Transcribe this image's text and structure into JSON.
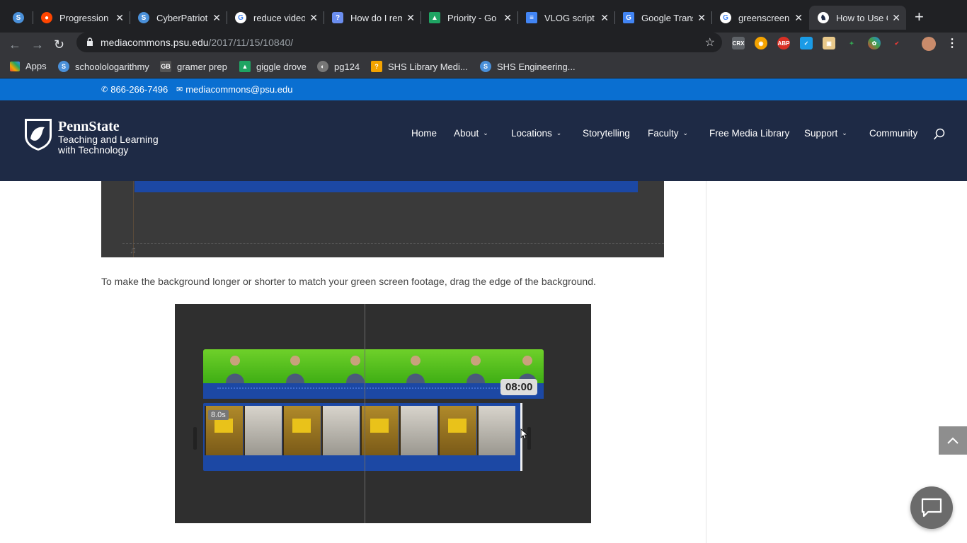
{
  "browser": {
    "tabs": [
      {
        "title": "",
        "icon": "schoology-icon",
        "color": "#4a90d9"
      },
      {
        "title": "Progression",
        "icon": "reddit-icon",
        "color": "#ff4500"
      },
      {
        "title": "CyberPatriot",
        "icon": "schoology-icon",
        "color": "#4a90d9"
      },
      {
        "title": "reduce video",
        "icon": "google-icon",
        "color": "#ffffff"
      },
      {
        "title": "How do I rem",
        "icon": "help-icon",
        "color": "#6b8ef0"
      },
      {
        "title": "Priority - Go",
        "icon": "drive-icon",
        "color": "#1fa463"
      },
      {
        "title": "VLOG script",
        "icon": "docs-icon",
        "color": "#4285f4"
      },
      {
        "title": "Google Trans",
        "icon": "translate-icon",
        "color": "#4285f4"
      },
      {
        "title": "greenscreen",
        "icon": "google-icon",
        "color": "#ffffff"
      },
      {
        "title": "How to Use G",
        "icon": "pennstate-icon",
        "color": "#ffffff"
      }
    ],
    "url_host": "mediacommons.psu.edu",
    "url_path": "/2017/11/15/10840/",
    "bookmarks": [
      {
        "label": "Apps",
        "icon": "apps-grid-icon",
        "color": "#e8453c"
      },
      {
        "label": "schoolologarithmy",
        "icon": "schoology-icon",
        "color": "#4a90d9"
      },
      {
        "label": "gramer prep",
        "icon": "gbi-icon",
        "color": "#555555"
      },
      {
        "label": "giggle drove",
        "icon": "drive-icon",
        "color": "#1fa463"
      },
      {
        "label": "pg124",
        "icon": "globe-icon",
        "color": "#777777"
      },
      {
        "label": "SHS Library Medi...",
        "icon": "library-icon",
        "color": "#f4a300"
      },
      {
        "label": "SHS Engineering...",
        "icon": "schoology-icon",
        "color": "#4a90d9"
      }
    ]
  },
  "site": {
    "phone": "866-266-7496",
    "email": "mediacommons@psu.edu",
    "logo_name": "PennState",
    "logo_sub": "Teaching and Learning with Technology",
    "nav": [
      "Home",
      "About",
      "Locations",
      "Storytelling",
      "Faculty",
      "Free Media Library",
      "Support",
      "Community"
    ]
  },
  "content": {
    "figure1_note": "♫",
    "paragraph": "To make the background longer or shorter to match your green screen footage, drag the edge of the background.",
    "clip_duration": "8.0s",
    "timecode": "08:00"
  },
  "colors": {
    "accent_blue": "#0a6fd1",
    "header_navy": "#1e2a45",
    "timeline_blue": "#1c48a4"
  }
}
